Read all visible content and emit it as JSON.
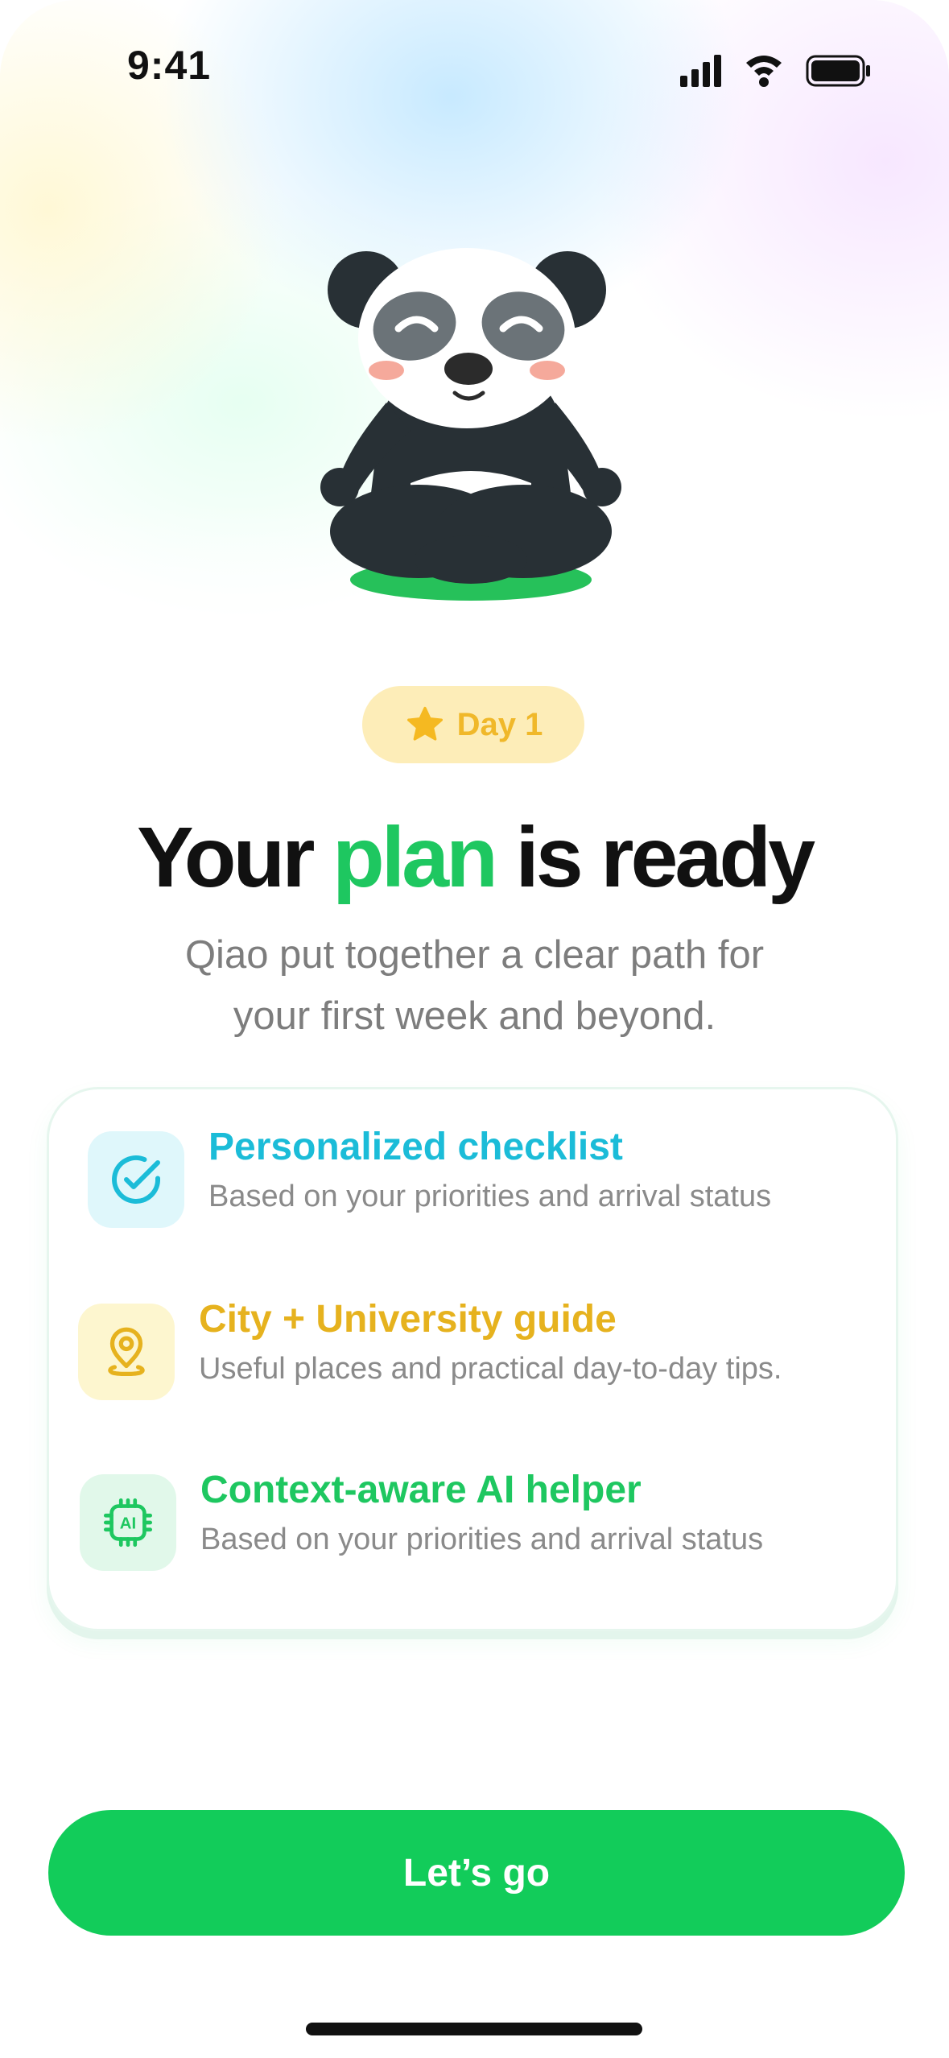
{
  "status_bar": {
    "time": "9:41"
  },
  "badge": {
    "label": "Day 1",
    "icon": "star-icon"
  },
  "header": {
    "title_part1": "Your",
    "title_accent": "plan",
    "title_part2": "is ready",
    "subtitle_line1": "Qiao put together a clear path for",
    "subtitle_line2": "your first week and beyond."
  },
  "features": [
    {
      "title": "Personalized checklist",
      "description": "Based on your priorities and arrival status",
      "icon": "check-circle-icon",
      "color": "#1bbcd8",
      "icon_bg": "#dff7fb"
    },
    {
      "title": "City + University guide",
      "description": "Useful places and practical day-to-day tips.",
      "icon": "map-pin-icon",
      "color": "#e6b21e",
      "icon_bg": "#fdf6cf"
    },
    {
      "title": "Context-aware AI helper",
      "description": "Based on your priorities and arrival status",
      "icon": "ai-chip-icon",
      "color": "#1ec760",
      "icon_bg": "#e1f8ea"
    }
  ],
  "cta": {
    "label": "Let’s go"
  },
  "colors": {
    "accent": "#1ec760",
    "button": "#12cc5a",
    "badge_bg": "#fdedb8",
    "badge_text": "#f0b82a"
  }
}
